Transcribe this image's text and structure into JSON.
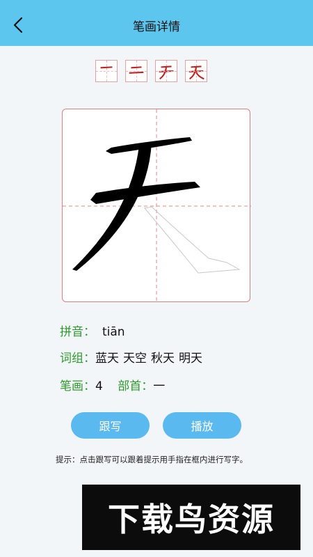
{
  "header": {
    "title": "笔画详情"
  },
  "stroke_steps": [
    "一",
    "二",
    "天",
    "天"
  ],
  "character": "天",
  "info": {
    "pinyin_label": "拼音：",
    "pinyin": "tiān",
    "words_label": "词组：",
    "words": [
      "蓝天",
      "天空",
      "秋天",
      "明天"
    ],
    "strokes_label": "笔画：",
    "strokes": "4",
    "radical_label": "部首：",
    "radical": "一"
  },
  "buttons": {
    "trace": "跟写",
    "play": "播放"
  },
  "hint": "提示：点击跟写可以跟着提示用手指在框内进行写字。",
  "watermark": "下载鸟资源",
  "colors": {
    "header": "#5cc6ef",
    "button": "#5ab9ef",
    "label": "#2e9a2e",
    "grid": "#d98080"
  }
}
